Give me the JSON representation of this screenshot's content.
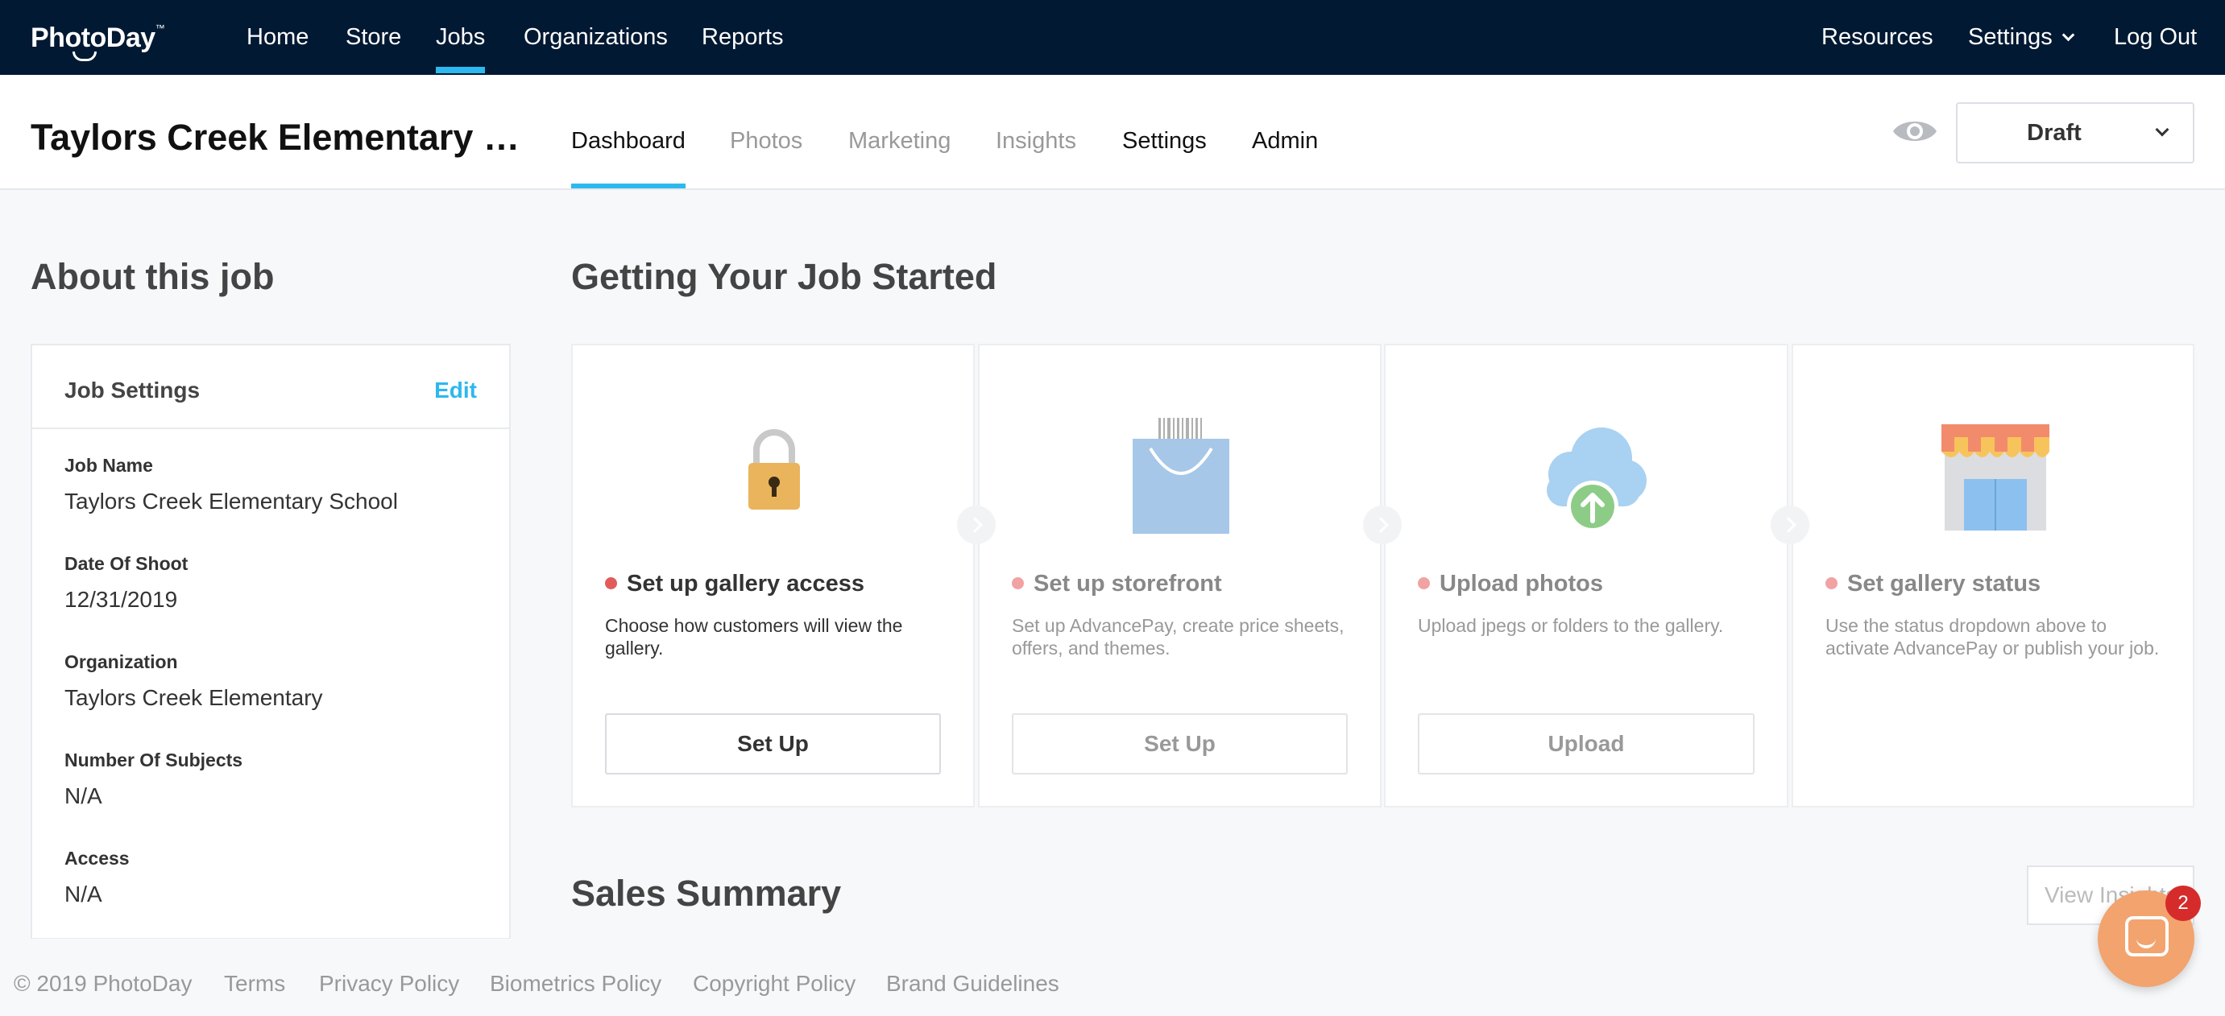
{
  "app": {
    "logo_text": "PhotoDay",
    "logo_mark": "™"
  },
  "topnav": {
    "items": [
      "Home",
      "Store",
      "Jobs",
      "Organizations",
      "Reports"
    ],
    "active": "Jobs",
    "right_items": [
      "Resources",
      "Settings",
      "Log Out"
    ]
  },
  "job": {
    "title": "Taylors Creek Elementary …",
    "tabs": [
      "Dashboard",
      "Photos",
      "Marketing",
      "Insights",
      "Settings",
      "Admin"
    ],
    "active_tab": "Dashboard",
    "status": "Draft"
  },
  "about": {
    "heading": "About this job",
    "card_title": "Job Settings",
    "edit_label": "Edit",
    "fields": [
      {
        "label": "Job Name",
        "value": "Taylors Creek Elementary School"
      },
      {
        "label": "Date Of Shoot",
        "value": "12/31/2019"
      },
      {
        "label": "Organization",
        "value": "Taylors Creek Elementary"
      },
      {
        "label": "Number Of Subjects",
        "value": "N/A"
      },
      {
        "label": "Access",
        "value": "N/A"
      }
    ]
  },
  "getting_started": {
    "heading": "Getting Your Job Started",
    "steps": [
      {
        "title": "Set up gallery access",
        "description": "Choose how customers will view the gallery.",
        "button": "Set Up",
        "icon": "padlock-icon"
      },
      {
        "title": "Set up storefront",
        "description": "Set up AdvancePay, create price sheets, offers, and themes.",
        "button": "Set Up",
        "icon": "shopping-bag-icon"
      },
      {
        "title": "Upload photos",
        "description": "Upload jpegs or folders to the gallery.",
        "button": "Upload",
        "icon": "cloud-upload-icon"
      },
      {
        "title": "Set gallery status",
        "description": "Use the status dropdown above to activate AdvancePay or publish your job.",
        "button": "",
        "icon": "storefront-icon"
      }
    ]
  },
  "sales": {
    "heading": "Sales Summary",
    "view_button": "View Insights"
  },
  "footer": {
    "copyright": "© 2019 PhotoDay",
    "links": [
      "Terms",
      "Privacy Policy",
      "Biometrics Policy",
      "Copyright Policy",
      "Brand Guidelines"
    ]
  },
  "chat": {
    "unread": "2"
  },
  "colors": {
    "nav_bg": "#021933",
    "accent": "#2db8ee",
    "status_dot": "#e25b5b",
    "chat": "#f3a36d"
  }
}
